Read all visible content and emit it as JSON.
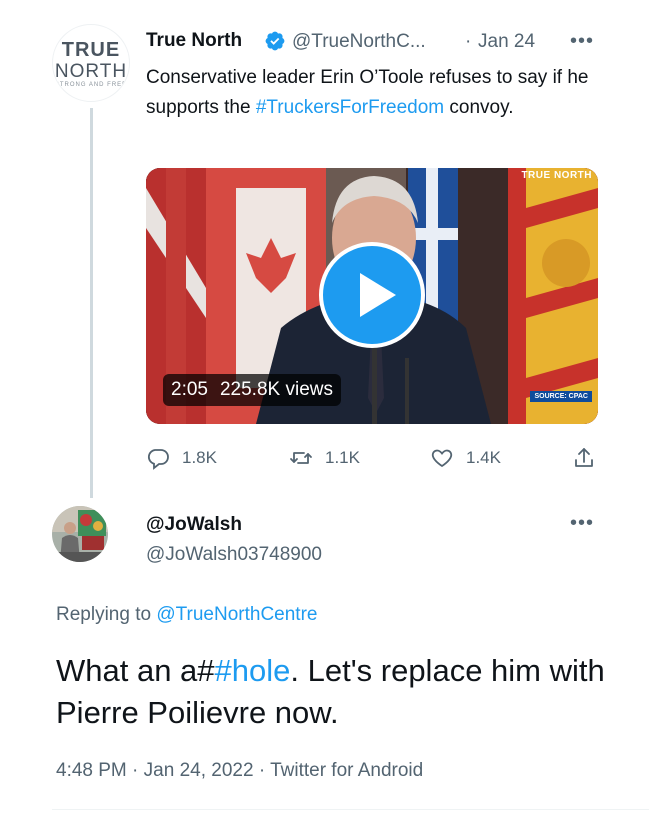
{
  "original_tweet": {
    "author_name": "True North",
    "handle": "@TrueNorthC...",
    "separator": "·",
    "date": "Jan 24",
    "more": "•••",
    "logo": {
      "line1": "TRUE",
      "line2": "NORTH",
      "tagline": "STRONG AND FREE"
    },
    "text_before": "Conservative leader Erin O’Toole refuses to say if he supports the ",
    "hashtag": "#TruckersForFreedom",
    "text_after": " convoy.",
    "video": {
      "duration": "2:05",
      "views": "225.8K views",
      "watermark": "TRUE NORTH",
      "source": "SOURCE: CPAC"
    },
    "actions": {
      "replies": "1.8K",
      "retweets": "1.1K",
      "likes": "1.4K"
    }
  },
  "reply_tweet": {
    "author_name": "@JoWalsh",
    "handle": "@JoWalsh03748900",
    "more": "•••",
    "replying_label": "Replying to ",
    "replying_to": "@TrueNorthCentre",
    "text_before": "What an a#",
    "hashtag": "#hole",
    "text_after": ". Let's replace him with Pierre Poilievre now.",
    "time": "4:48 PM",
    "sep": "·",
    "date": "Jan 24, 2022",
    "sep2": "·",
    "client": "Twitter for Android"
  },
  "colors": {
    "link": "#1d9bf0",
    "secondary_text": "#536471",
    "primary_text": "#0f1419",
    "thread_line": "#cfd9de"
  }
}
